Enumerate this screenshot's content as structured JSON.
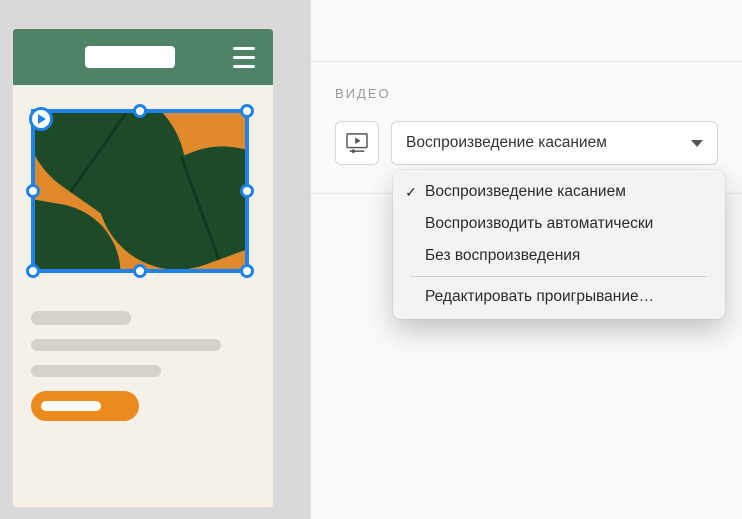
{
  "inspector": {
    "section_title": "ВИДЕО",
    "dropdown_selected": "Воспроизведение касанием",
    "menu": {
      "item1": "Воспроизведение касанием",
      "item2": "Воспроизводить автоматически",
      "item3": "Без воспроизведения",
      "item4": "Редактировать проигрывание…"
    }
  }
}
